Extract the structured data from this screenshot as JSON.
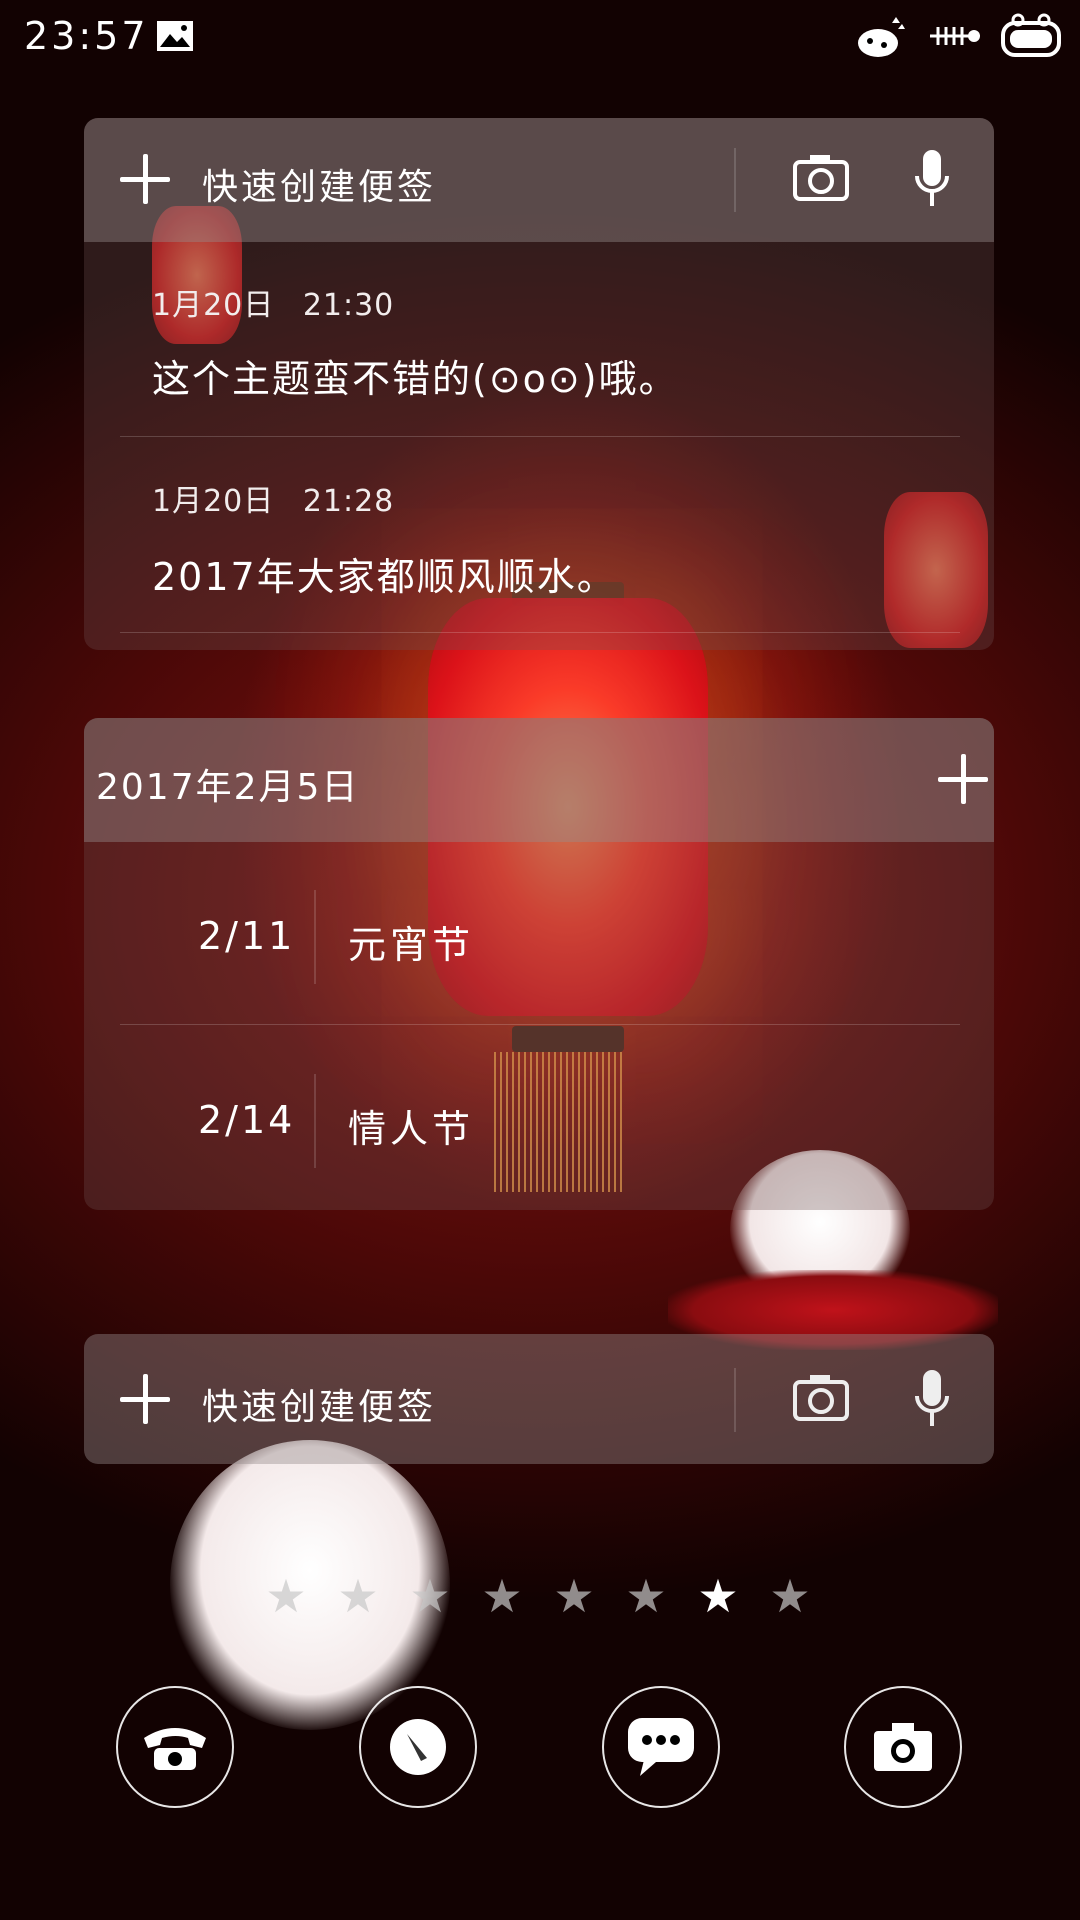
{
  "status_bar": {
    "time": "23:57",
    "icons": [
      "image-icon",
      "cat-notification-icon",
      "fishbone-signal-icon",
      "battery-icon"
    ]
  },
  "note_widget_top": {
    "quick_create_label": "快速创建便签",
    "notes": [
      {
        "date": "1月20日",
        "time": "21:30",
        "text": "这个主题蛮不错的(⊙o⊙)哦。"
      },
      {
        "date": "1月20日",
        "time": "21:28",
        "text": "2017年大家都顺风顺水。"
      }
    ]
  },
  "calendar_widget": {
    "date_title": "2017年2月5日",
    "events": [
      {
        "date": "2/11",
        "name": "元宵节"
      },
      {
        "date": "2/14",
        "name": "情人节"
      }
    ]
  },
  "note_widget_bottom": {
    "quick_create_label": "快速创建便签"
  },
  "page_indicator": {
    "total": 8,
    "active_index": 6
  },
  "dock": [
    "phone-icon",
    "compass-icon",
    "message-icon",
    "camera-icon"
  ],
  "colors": {
    "background_dark": "#120202",
    "background_red": "#8a1412",
    "lantern_red": "#e0121a"
  }
}
